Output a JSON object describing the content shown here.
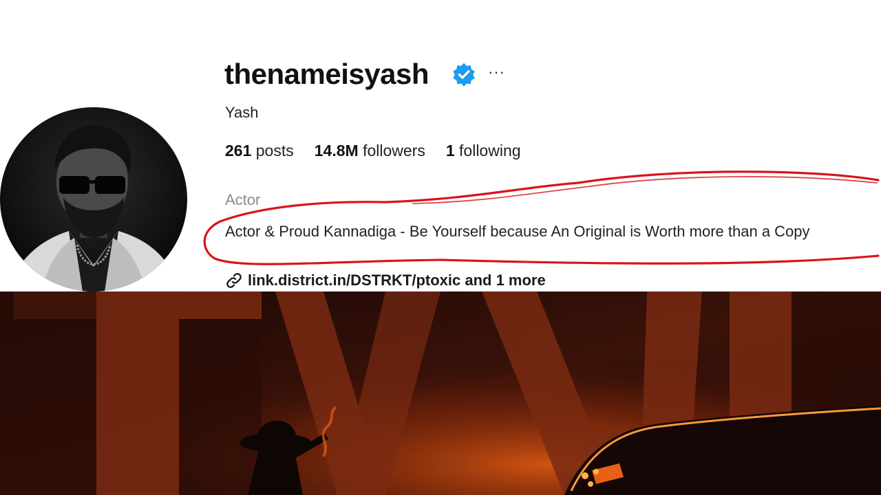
{
  "profile": {
    "username": "thenameisyash",
    "full_name": "Yash",
    "stats": {
      "posts_count": "261",
      "posts_label": "posts",
      "followers_count": "14.8M",
      "followers_label": "followers",
      "following_count": "1",
      "following_label": "following"
    },
    "category": "Actor",
    "bio": "Actor & Proud Kannadiga - Be Yourself because An Original is Worth more than a Copy",
    "link_text": "link.district.in/DSTRKT/ptoxic and 1 more",
    "icons": {
      "verified": "verified-badge-icon",
      "more": "more-options-icon",
      "link": "link-icon"
    },
    "more_glyph": "···"
  },
  "colors": {
    "verified_blue": "#1d9bf0",
    "annotation_red": "#d8141c",
    "poster_orange": "#c2410c"
  }
}
